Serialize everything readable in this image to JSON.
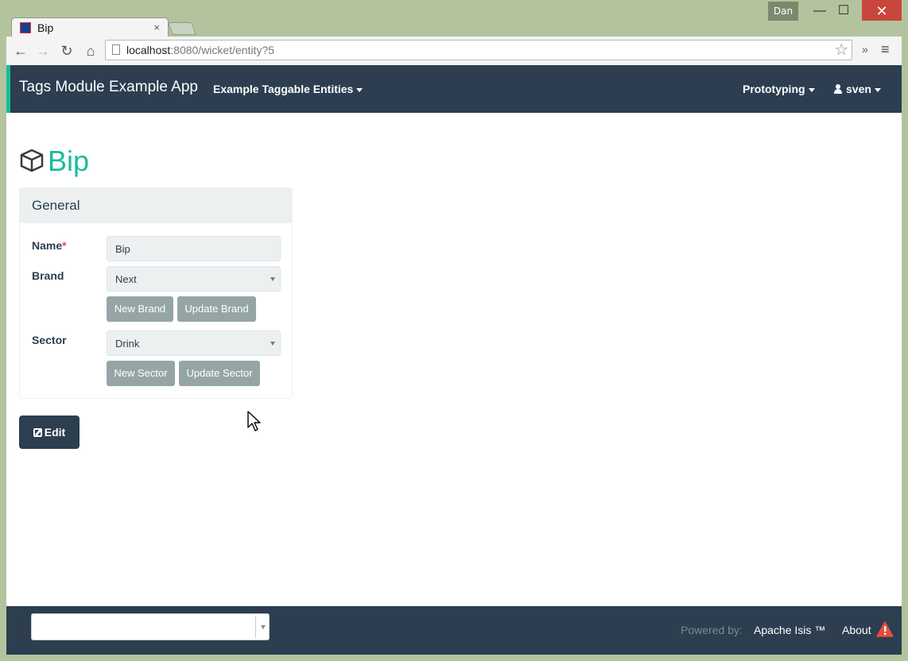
{
  "window": {
    "user_badge": "Dan",
    "minimize_glyph": "—",
    "maximize_glyph": "☐",
    "close_glyph": "✕"
  },
  "tab": {
    "title": "Bip",
    "close_glyph": "×"
  },
  "toolbar": {
    "url_host": "localhost",
    "url_rest": ":8080/wicket/entity?5",
    "back_glyph": "←",
    "forward_glyph": "→",
    "reload_glyph": "↻",
    "home_glyph": "⌂",
    "star_glyph": "☆",
    "extensions_glyph": "»",
    "menu_glyph": "≡"
  },
  "navbar": {
    "brand": "Tags Module Example App",
    "menu_entities": "Example Taggable Entities",
    "menu_prototyping": "Prototyping",
    "menu_user": "sven"
  },
  "entity": {
    "title": "Bip",
    "icon": "cube-icon"
  },
  "panel": {
    "title": "General",
    "name_label": "Name",
    "required_marker": "*",
    "name_value": "Bip",
    "brand_label": "Brand",
    "brand_value": "Next",
    "new_brand": "New Brand",
    "update_brand": "Update Brand",
    "sector_label": "Sector",
    "sector_value": "Drink",
    "new_sector": "New Sector",
    "update_sector": "Update Sector"
  },
  "actions": {
    "edit_label": "Edit"
  },
  "footer": {
    "powered_by": "Powered by:",
    "framework": "Apache Isis ™",
    "about": "About"
  },
  "colors": {
    "navbar": "#2c3e50",
    "accent": "#18bc9c",
    "button_gray": "#95a5a6",
    "warning": "#e74c3c"
  }
}
